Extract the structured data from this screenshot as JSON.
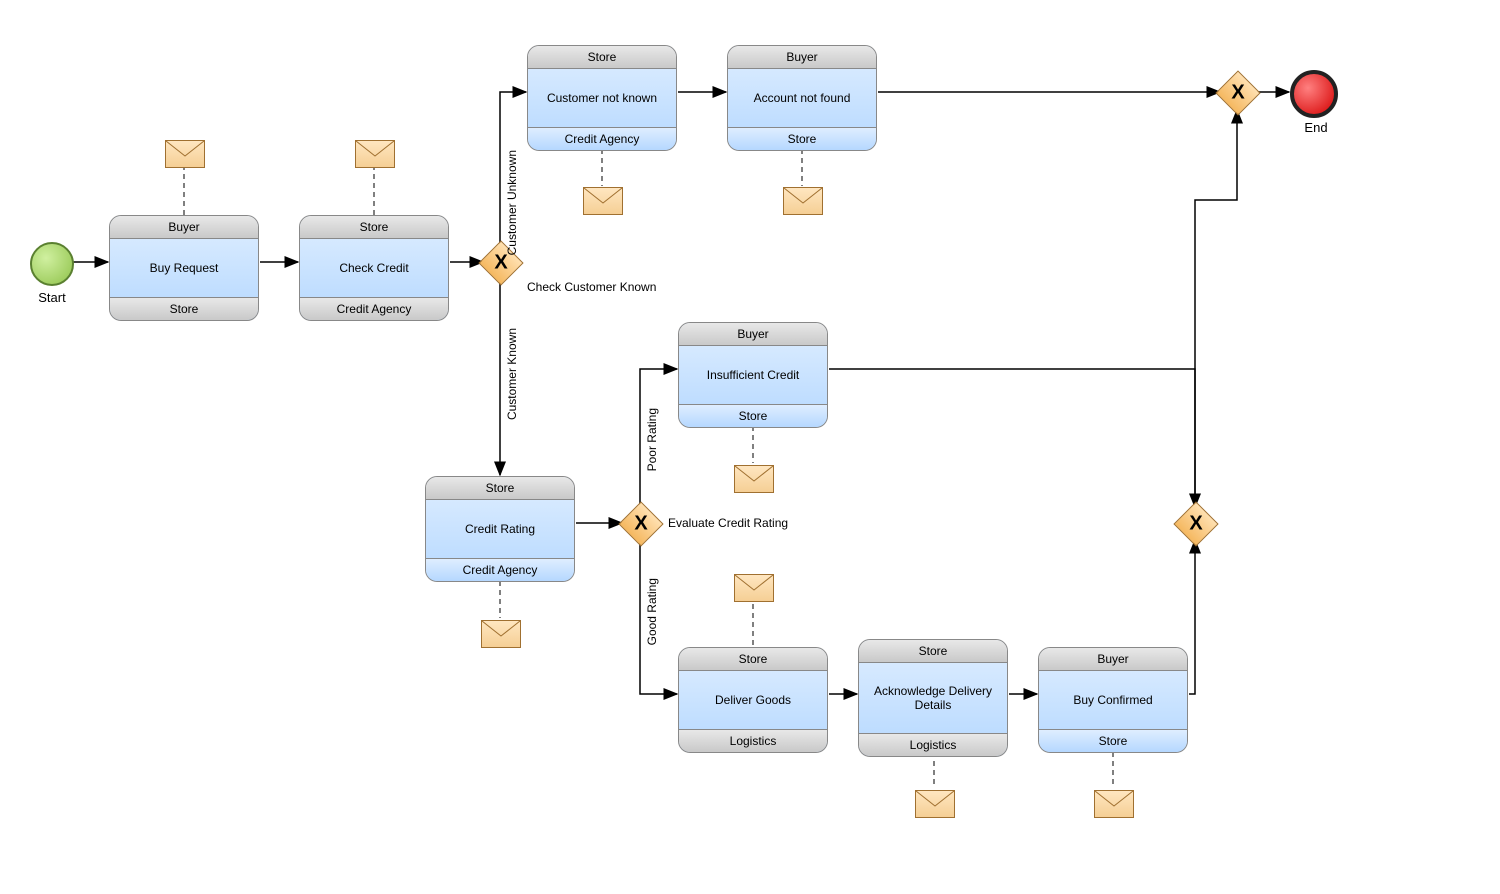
{
  "start_label": "Start",
  "end_label": "End",
  "tasks": {
    "buy_request": {
      "head": "Buyer",
      "body": "Buy Request",
      "foot": "Store",
      "footgray": true
    },
    "check_credit": {
      "head": "Store",
      "body": "Check Credit",
      "foot": "Credit Agency",
      "footgray": true
    },
    "cust_not_known": {
      "head": "Store",
      "body": "Customer not known",
      "foot": "Credit Agency",
      "footgray": false
    },
    "acct_not_found": {
      "head": "Buyer",
      "body": "Account not found",
      "foot": "Store",
      "footgray": false
    },
    "credit_rating": {
      "head": "Store",
      "body": "Credit Rating",
      "foot": "Credit Agency",
      "footgray": false
    },
    "insuf_credit": {
      "head": "Buyer",
      "body": "Insufficient Credit",
      "foot": "Store",
      "footgray": false
    },
    "deliver_goods": {
      "head": "Store",
      "body": "Deliver Goods",
      "foot": "Logistics",
      "footgray": true
    },
    "ack_delivery": {
      "head": "Store",
      "body": "Acknowledge Delivery Details",
      "foot": "Logistics",
      "footgray": true
    },
    "buy_confirmed": {
      "head": "Buyer",
      "body": "Buy Confirmed",
      "foot": "Store",
      "footgray": false
    }
  },
  "gateways": {
    "g1_label": "Check Customer Known",
    "g2_label": "Evaluate Credit Rating"
  },
  "edge_labels": {
    "cust_unknown": "Customer Unknown",
    "cust_known": "Customer Known",
    "poor": "Poor Rating",
    "good": "Good Rating"
  }
}
